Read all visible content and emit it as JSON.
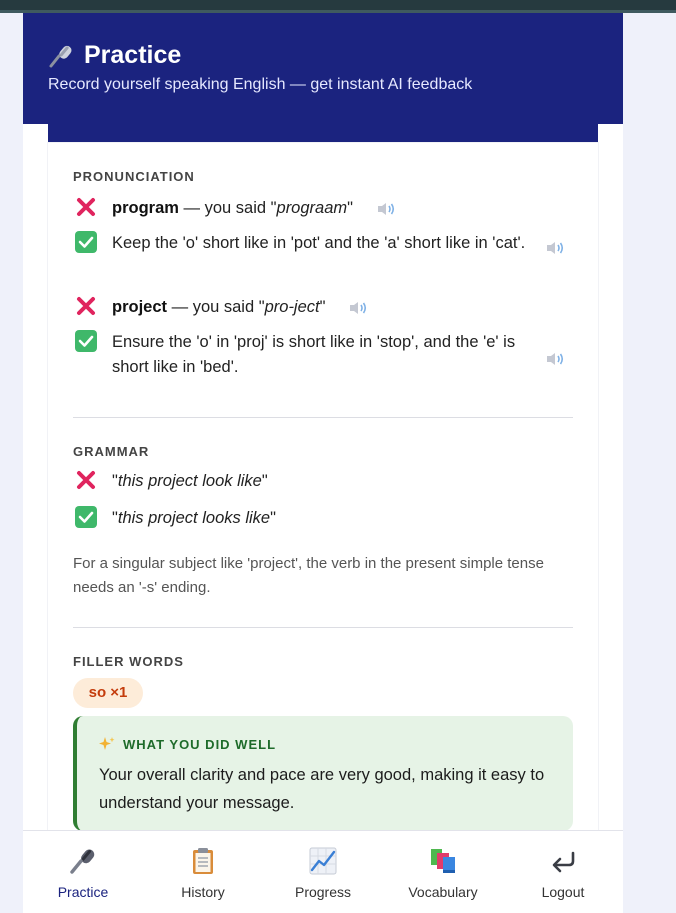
{
  "header": {
    "title": "Practice",
    "subtitle": "Record yourself speaking English — get instant AI feedback",
    "icon": "microphone-icon"
  },
  "pronunciation": {
    "label": "PRONUNCIATION",
    "items": [
      {
        "word": "program",
        "said_prefix": "— you said \"",
        "said": "prograam",
        "said_suffix": "\"",
        "tip": "Keep the 'o' short like in 'pot' and the 'a' short like in 'cat'."
      },
      {
        "word": "project",
        "said_prefix": "— you said \"",
        "said": "pro-ject",
        "said_suffix": "\"",
        "tip": "Ensure the 'o' in 'proj' is short like in 'stop', and the 'e' is short like in 'bed'."
      }
    ]
  },
  "grammar": {
    "label": "GRAMMAR",
    "wrong": "this project look like",
    "right": "this project looks like",
    "explanation": "For a singular subject like 'project', the verb in the present simple tense needs an '-s' ending."
  },
  "filler": {
    "label": "FILLER WORDS",
    "chip": "so ×1"
  },
  "well": {
    "label": "WHAT YOU DID WELL",
    "text": "Your overall clarity and pace are very good, making it easy to understand your message."
  },
  "nav": [
    {
      "label": "Practice",
      "icon": "microphone-icon",
      "active": true
    },
    {
      "label": "History",
      "icon": "clipboard-icon",
      "active": false
    },
    {
      "label": "Progress",
      "icon": "chart-increasing-icon",
      "active": false
    },
    {
      "label": "Vocabulary",
      "icon": "books-icon",
      "active": false
    },
    {
      "label": "Logout",
      "icon": "return-arrow-icon",
      "active": false
    }
  ],
  "colors": {
    "header_bg": "#1b237f",
    "error_icon": "#e0245e",
    "check_icon": "#3fb86a",
    "chip_bg": "#fdecd9",
    "chip_text": "#c43c0c",
    "well_bg": "#e6f3e6",
    "well_border": "#2f7d32"
  }
}
